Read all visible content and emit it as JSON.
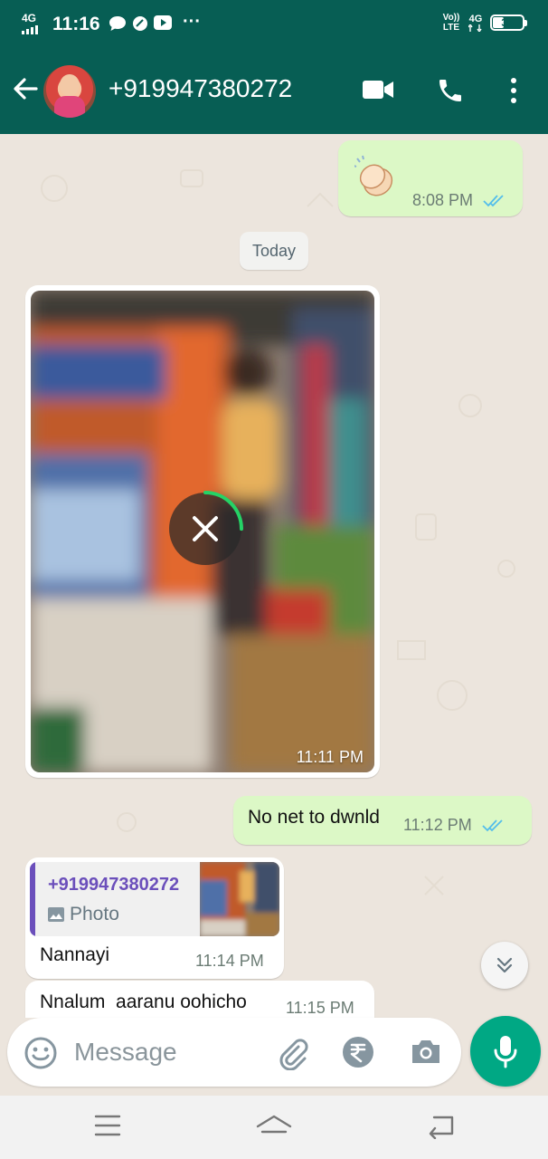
{
  "status_bar": {
    "network": "4G",
    "time": "11:16",
    "volte": "Vo)) LTE",
    "lte": "4G",
    "battery": "35",
    "battery_level": 0.35
  },
  "header": {
    "contact_name": "+919947380272"
  },
  "messages": {
    "clap_time": "8:08 PM",
    "date_divider": "Today",
    "photo_time": "11:11 PM",
    "no_net_text": "No net to dwnld",
    "no_net_time": "11:12 PM",
    "reply_quote_name": "+919947380272",
    "reply_quote_type": "Photo",
    "reply_text": "Nannayi",
    "reply_time": "11:14 PM",
    "last_text": "Nnalum  aaranu oohicho",
    "last_time": "11:15 PM",
    "download_progress": 0.25
  },
  "composer": {
    "placeholder": "Message"
  },
  "colors": {
    "header": "#075e54",
    "outgoing": "#dcf8c6",
    "read_ticks": "#53bdeb",
    "accent": "#00a884",
    "quote_name": "#6b4fbb"
  },
  "icons": [
    "back-arrow-icon",
    "video-call-icon",
    "phone-icon",
    "more-vert-icon",
    "double-tick-icon",
    "cancel-download-icon",
    "scroll-down-icon",
    "emoji-icon",
    "attach-icon",
    "rupee-icon",
    "camera-icon",
    "mic-icon",
    "recent-apps-icon",
    "home-icon",
    "back-nav-icon"
  ]
}
